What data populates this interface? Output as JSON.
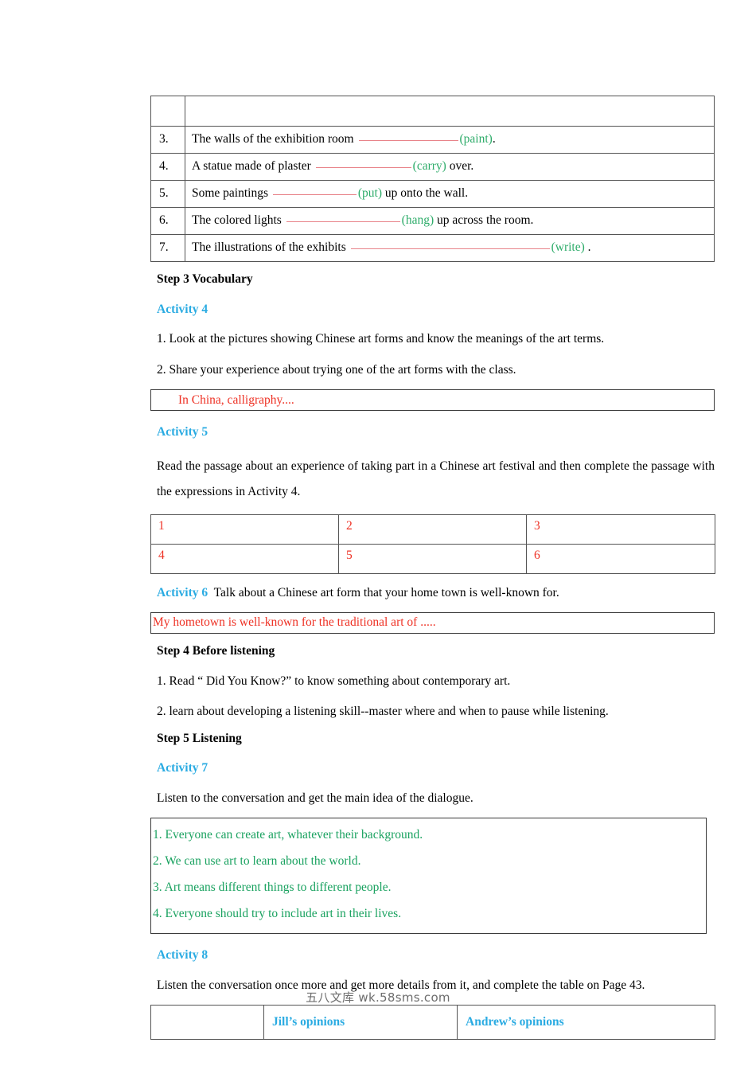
{
  "verb_table": {
    "rows": [
      {
        "num": "",
        "before": "",
        "blank_width": 0,
        "hint": "",
        "after": "",
        "empty": true
      },
      {
        "num": "3.",
        "before": "The walls of the exhibition room ",
        "blank_width": 125,
        "hint": "(paint)",
        "after": "."
      },
      {
        "num": "4.",
        "before": "A statue made of plaster ",
        "blank_width": 120,
        "hint": "(carry)",
        "after": " over."
      },
      {
        "num": "5.",
        "before": "Some paintings ",
        "blank_width": 105,
        "hint": "(put)",
        "after": " up onto the wall."
      },
      {
        "num": "6.",
        "before": "The colored lights ",
        "blank_width": 143,
        "hint": "(hang)",
        "after": " up across the room."
      },
      {
        "num": "7.",
        "before": "The illustrations of the exhibits ",
        "blank_width": 250,
        "hint": "(write)",
        "after": " ."
      }
    ]
  },
  "step3": {
    "heading": "Step 3  Vocabulary",
    "activity4_label": "Activity 4",
    "instruction_1": "1. Look at the pictures showing Chinese art forms and know the meanings of the art terms.",
    "instruction_2": "2. Share your experience about trying one of the art forms with the class.",
    "sample_answer": "In China, calligraphy...."
  },
  "activity5": {
    "label": "Activity 5",
    "instruction": "Read the passage about an experience of taking part in a Chinese art festival and then complete the passage with the expressions in Activity 4.",
    "grid": [
      [
        "1",
        "2",
        "3"
      ],
      [
        "4",
        "5",
        "6"
      ]
    ]
  },
  "activity6": {
    "label": "Activity 6",
    "instruction": "Talk about a Chinese art form that your home town is well-known for.",
    "sample_answer": "My hometown is well-known for the traditional art of ....."
  },
  "step4": {
    "heading": "Step 4  Before listening",
    "instruction_1": "1. Read “ Did You Know?” to know something about contemporary art.",
    "instruction_2": "2. learn about developing a listening skill--master where and when to pause while listening."
  },
  "step5": {
    "heading": "Step 5  Listening",
    "activity7_label": "Activity 7",
    "activity7_instruction": "Listen to the conversation and get the main idea of the dialogue.",
    "activity7_answers": [
      "1. Everyone can create art, whatever their background.",
      "2. We can use art to learn about the world.",
      "3. Art means different things to different people.",
      "4. Everyone should try to include art in their lives."
    ]
  },
  "activity8": {
    "label": "Activity 8",
    "instruction": "Listen the conversation once more and get more details from it, and complete the table on Page 43.",
    "table_headers": [
      "",
      "Jill’s opinions",
      "Andrew’s opinions"
    ]
  },
  "footer": {
    "watermark": "五八文库 wk.58sms.com"
  },
  "colors": {
    "activity_blue": "#2aabe2",
    "hint_green": "#2eac6a",
    "answer_green": "#1aa260",
    "sample_red": "#ee3124",
    "blank_line": "#e8848a",
    "border": "#545454"
  }
}
